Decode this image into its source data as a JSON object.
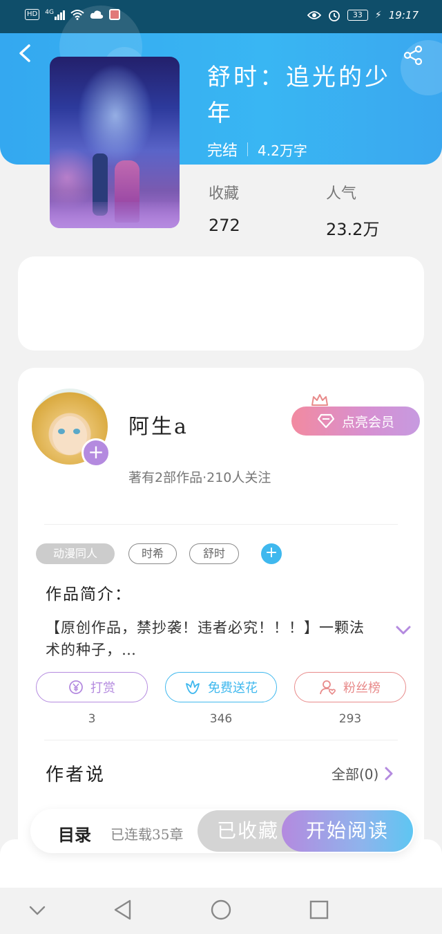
{
  "status_bar": {
    "left_icons": [
      "hd-icon",
      "4g-signal-icon",
      "wifi-icon",
      "cloud-icon",
      "app-notification-icon"
    ],
    "hd": "HD",
    "network": "4G",
    "battery": "33",
    "time": "19:17"
  },
  "book": {
    "title": "舒时：追光的少年",
    "status": "完结",
    "word_count": "4.2万字",
    "stats": {
      "favorites_label": "收藏",
      "favorites_value": "272",
      "popularity_label": "人气",
      "popularity_value": "23.2万"
    }
  },
  "author": {
    "name": "阿生a",
    "summary": "著有2部作品·210人关注",
    "vip_button": "点亮会员"
  },
  "tags": [
    "动漫同人",
    "时希",
    "舒时"
  ],
  "intro": {
    "title": "作品简介：",
    "text": "【原创作品，禁抄袭！违者必究！！！】一颗法术的种子，…"
  },
  "actions": [
    {
      "label": "打赏",
      "count": "3",
      "color": "#b48adf"
    },
    {
      "label": "免费送花",
      "count": "346",
      "color": "#3fb8ee"
    },
    {
      "label": "粉丝榜",
      "count": "293",
      "color": "#e88a8a"
    }
  ],
  "author_says": {
    "title": "作者说",
    "all_link": "全部(0)"
  },
  "bottom_bar": {
    "toc": "目录",
    "serial": "已连载35章",
    "favorited": "已收藏",
    "start_reading": "开始阅读"
  },
  "colors": {
    "hero": "#36aef1",
    "accent_purple": "#b48adf",
    "accent_blue": "#3fb8ee",
    "accent_red": "#e88a8a"
  }
}
